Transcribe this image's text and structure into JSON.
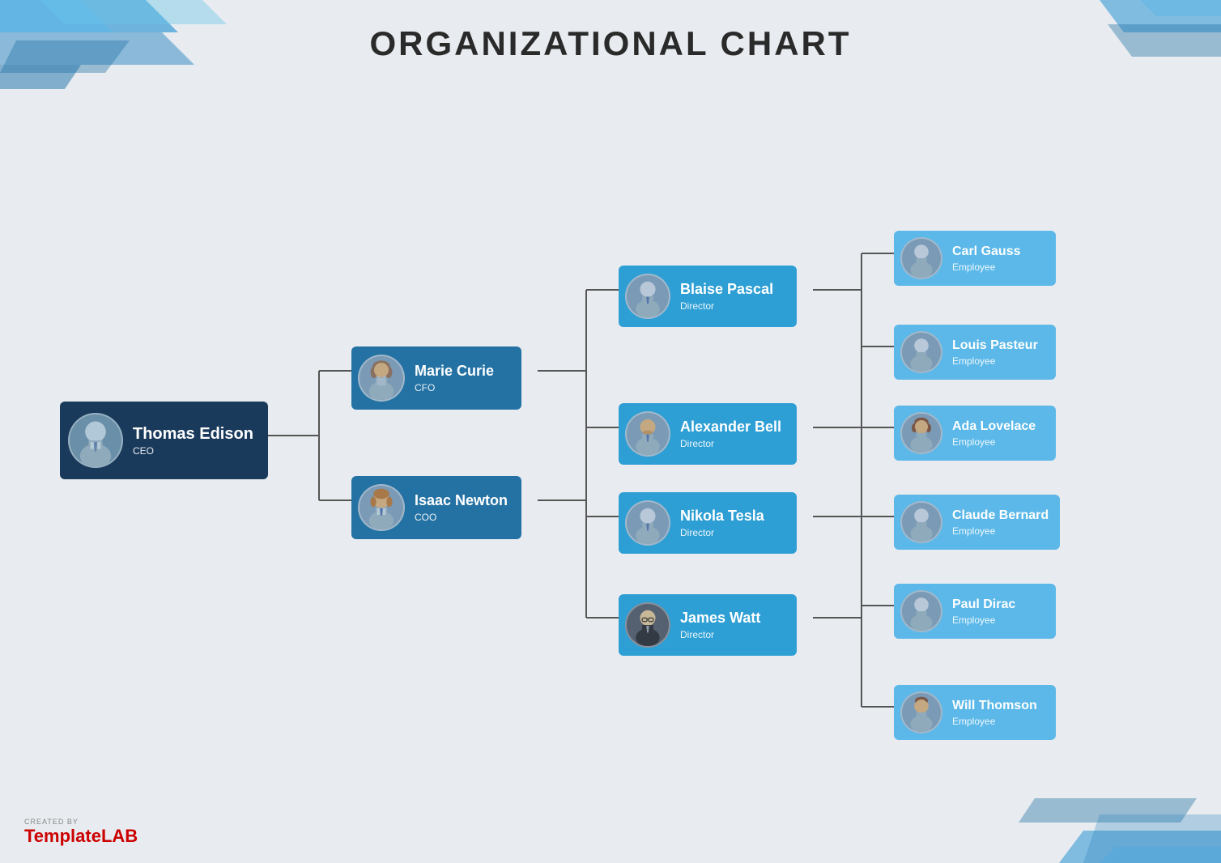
{
  "title": "ORGANIZATIONAL CHART",
  "watermark": {
    "created_by": "CREATED BY",
    "brand_normal": "Template",
    "brand_bold": "LAB"
  },
  "nodes": {
    "ceo": {
      "name": "Thomas Edison",
      "role": "CEO"
    },
    "mid": [
      {
        "name": "Marie Curie",
        "role": "CFO"
      },
      {
        "name": "Isaac Newton",
        "role": "COO"
      }
    ],
    "directors": [
      {
        "name": "Blaise Pascal",
        "role": "Director"
      },
      {
        "name": "Alexander Bell",
        "role": "Director"
      },
      {
        "name": "Nikola Tesla",
        "role": "Director"
      },
      {
        "name": "James Watt",
        "role": "Director"
      }
    ],
    "employees": [
      {
        "name": "Carl Gauss",
        "role": "Employee"
      },
      {
        "name": "Louis Pasteur",
        "role": "Employee"
      },
      {
        "name": "Ada Lovelace",
        "role": "Employee"
      },
      {
        "name": "Claude Bernard",
        "role": "Employee"
      },
      {
        "name": "Paul Dirac",
        "role": "Employee"
      },
      {
        "name": "Will Thomson",
        "role": "Employee"
      }
    ]
  },
  "colors": {
    "ceo_bg": "#1a3a5c",
    "mid_bg": "#2472a4",
    "director_bg": "#2e9fd4",
    "employee_bg": "#5bb8e8",
    "avatar_bg": "#7a9ab5",
    "line_color": "#555555",
    "page_bg": "#e8ecf0",
    "title_color": "#2a2a2a"
  }
}
